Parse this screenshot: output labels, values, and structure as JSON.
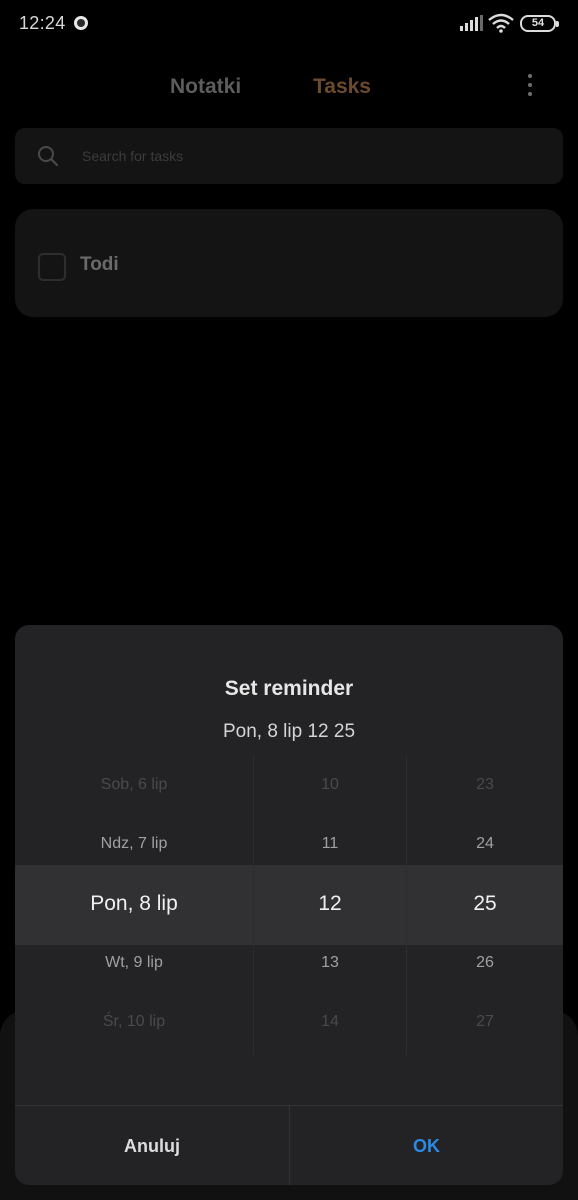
{
  "status_bar": {
    "time": "12:24",
    "battery": "54"
  },
  "header": {
    "tabs": [
      {
        "label": "Notatki"
      },
      {
        "label": "Tasks"
      }
    ]
  },
  "search": {
    "placeholder": "Search for tasks"
  },
  "tasks": [
    {
      "title": "Todi",
      "checked": false
    }
  ],
  "dialog": {
    "title": "Set reminder",
    "selected_summary": "Pon, 8 lip 12 25",
    "date_column": [
      "Sob, 6 lip",
      "Ndz, 7 lip",
      "Pon, 8 lip",
      "Wt, 9 lip",
      "Śr, 10 lip"
    ],
    "hour_column": [
      "10",
      "11",
      "12",
      "13",
      "14"
    ],
    "minute_column": [
      "23",
      "24",
      "25",
      "26",
      "27"
    ],
    "cancel_label": "Anuluj",
    "ok_label": "OK"
  },
  "colors": {
    "accent_ok": "#2b8ae6",
    "active_tab": "#6b4a2e"
  }
}
